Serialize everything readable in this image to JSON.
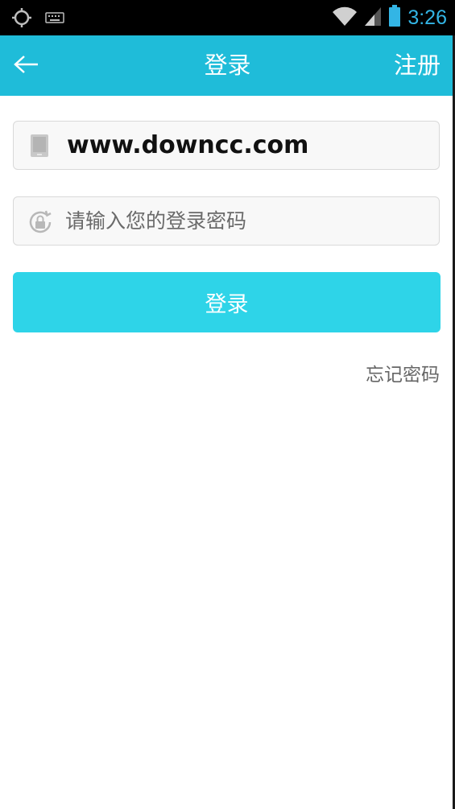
{
  "status_bar": {
    "time": "3:26",
    "icons": [
      "gps-icon",
      "keyboard-icon",
      "wifi-icon",
      "signal-icon",
      "battery-icon"
    ],
    "clock_color": "#33b5e5"
  },
  "app_bar": {
    "title": "登录",
    "register_label": "注册",
    "back_icon": "back-arrow-icon",
    "background": "#1fbcd9"
  },
  "form": {
    "phone": {
      "value": "www.downcc.com",
      "icon": "phone-icon"
    },
    "password": {
      "value": "",
      "placeholder": "请输入您的登录密码",
      "icon": "lock-icon"
    },
    "login_label": "登录",
    "login_color": "#2ed4e8",
    "forgot_label": "忘记密码"
  }
}
